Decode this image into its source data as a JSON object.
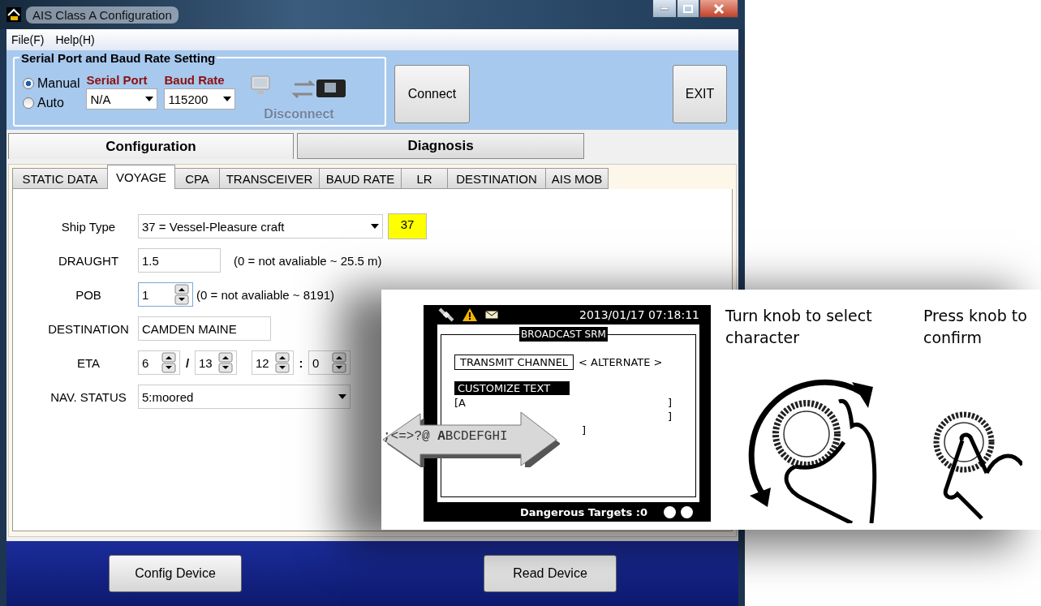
{
  "window": {
    "title": "AIS Class A Configuration"
  },
  "menu": [
    {
      "label": "File(F)"
    },
    {
      "label": "Help(H)"
    }
  ],
  "serial_settings": {
    "title": "Serial Port and Baud Rate Setting",
    "modes": [
      {
        "label": "Manual",
        "selected": true
      },
      {
        "label": "Auto",
        "selected": false
      }
    ],
    "serial_port": {
      "label": "Serial Port",
      "value": "N/A"
    },
    "baud_rate": {
      "label": "Baud Rate",
      "value": "115200"
    },
    "disconnect": {
      "label": "Disconnect",
      "disabled": true
    }
  },
  "buttons": {
    "connect": "Connect",
    "exit": "EXIT"
  },
  "main_tabs": [
    {
      "label": "Configuration",
      "selected": true
    },
    {
      "label": "Diagnosis",
      "selected": false
    }
  ],
  "sub_tabs": [
    {
      "label": "STATIC DATA",
      "selected": false
    },
    {
      "label": "VOYAGE",
      "selected": true
    },
    {
      "label": "CPA",
      "selected": false
    },
    {
      "label": "TRANSCEIVER",
      "selected": false
    },
    {
      "label": "BAUD RATE",
      "selected": false
    },
    {
      "label": "LR",
      "selected": false
    },
    {
      "label": "DESTINATION",
      "selected": false
    },
    {
      "label": "AIS MOB",
      "selected": false
    }
  ],
  "form": [
    {
      "kind": "select",
      "label": "Ship Type",
      "value": "37 = Vessel-Pleasure craft",
      "badge": "37"
    },
    {
      "kind": "text",
      "label": "DRAUGHT",
      "value": "1.5",
      "hint": "(0 = not avaliable ~ 25.5 m)"
    },
    {
      "kind": "spin",
      "label": "POB",
      "value": "1",
      "hint": "(0 = not avaliable ~ 8191)"
    },
    {
      "kind": "text",
      "label": "DESTINATION",
      "value": "CAMDEN MAINE"
    },
    {
      "kind": "eta",
      "label": "ETA",
      "parts": [
        {
          "value": "6",
          "sep": "/"
        },
        {
          "value": "13"
        },
        {
          "value": "12",
          "sep": ":"
        },
        {
          "value": "0"
        }
      ]
    },
    {
      "kind": "select",
      "label": "NAV. STATUS",
      "value": "5:moored"
    }
  ],
  "bottom_buttons": [
    "Config Device",
    "Read Device"
  ],
  "illustration": {
    "device_screen": {
      "datetime": "2013/01/17 07:18:11",
      "title": "BROADCAST SRM",
      "channel_label": "TRANSMIT CHANNEL",
      "channel_value": "< ALTERNATE >",
      "text_label": "CUSTOMIZE TEXT",
      "lines": [
        {
          "start": "[A",
          "end": "]"
        },
        {
          "end": "]"
        },
        {
          "end": "]"
        }
      ],
      "footer": "Dangerous Targets :0"
    },
    "character_strip": ";<=>?@ **A**BCDEFGHI",
    "steps": [
      "Turn knob to select character",
      "Press knob to confirm"
    ]
  }
}
